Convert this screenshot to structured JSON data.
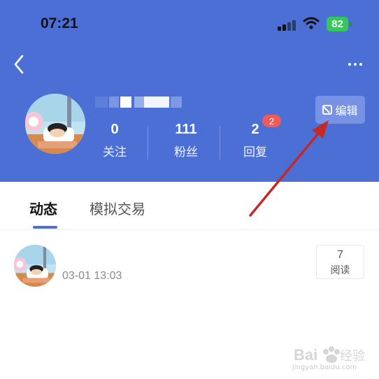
{
  "status_bar": {
    "time": "07:21",
    "battery": "82"
  },
  "profile": {
    "stats": [
      {
        "value": "0",
        "label": "关注"
      },
      {
        "value": "111",
        "label": "粉丝"
      },
      {
        "value": "2",
        "label": "回复"
      }
    ],
    "reply_badge": "2",
    "edit_label": "编辑"
  },
  "tabs": [
    {
      "label": "动态",
      "active": true
    },
    {
      "label": "模拟交易",
      "active": false
    }
  ],
  "post": {
    "time": "03-01 13:03",
    "read_count": "7",
    "read_label": "阅读"
  },
  "watermark": {
    "text": "jingyan.baidu.com"
  },
  "colors": {
    "header": "#4c6fd6",
    "edit_button": "#7792e3",
    "badge": "#ef5b5b",
    "annotation_arrow": "#c62828",
    "battery": "#34c759"
  }
}
